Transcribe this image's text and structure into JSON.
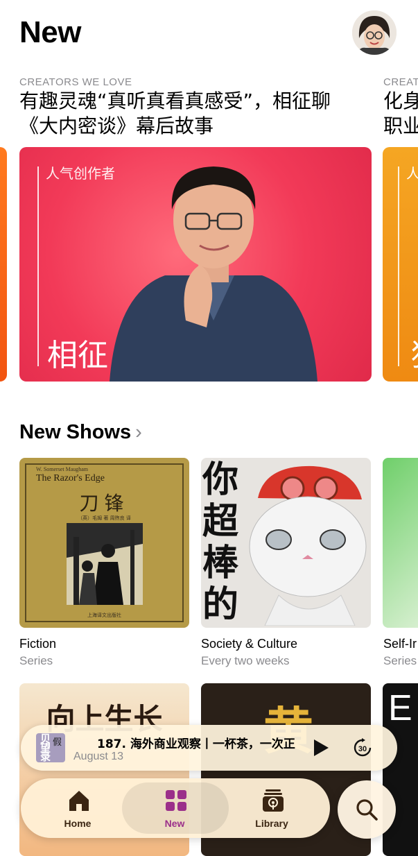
{
  "header": {
    "title": "New"
  },
  "featured": [
    {
      "eyebrow": "CREATORS WE LOVE",
      "headline_line1": "有趣灵魂“真听真看真感受”，相征聊",
      "headline_line2": "《大内密谈》幕后故事",
      "tag": "人气创作者",
      "name": "相征"
    },
    {
      "eyebrow": "CREAT",
      "headline_line1": "化身",
      "headline_line2": "职业",
      "tag": "人",
      "name": "狂"
    }
  ],
  "new_shows": {
    "title": "New Shows",
    "items": [
      {
        "genre": "Fiction",
        "frequency": "Series",
        "art_author": "W. Somerset Maugham",
        "art_title_en": "The Razor's Edge",
        "art_title_cn": "刀锋",
        "art_credit": "（英）毛姆 著  周煦良 译",
        "art_publisher": "上海译文出版社"
      },
      {
        "genre": "Society & Culture",
        "frequency": "Every two weeks",
        "art_title_cn": "你超棒的"
      },
      {
        "genre": "Self-Ir",
        "frequency": "Series"
      }
    ],
    "row2": [
      {
        "art_text": "向上生长"
      },
      {
        "art_text": "黄"
      },
      {
        "art_text": "E"
      }
    ]
  },
  "mini_player": {
    "art_text": "贝望录",
    "art_text2": "假",
    "title": "187. 海外商业观察丨一杯茶，一次正",
    "date": "August 13"
  },
  "tab_bar": {
    "tabs": [
      {
        "label": "Home",
        "icon": "home-icon"
      },
      {
        "label": "New",
        "icon": "grid-icon",
        "selected": true
      },
      {
        "label": "Library",
        "icon": "library-icon"
      }
    ],
    "search_icon": "search-icon"
  },
  "colors": {
    "accent": "#9b2f8a",
    "feature_red": "#f23a58",
    "secondary_text": "#8a8a8e"
  }
}
